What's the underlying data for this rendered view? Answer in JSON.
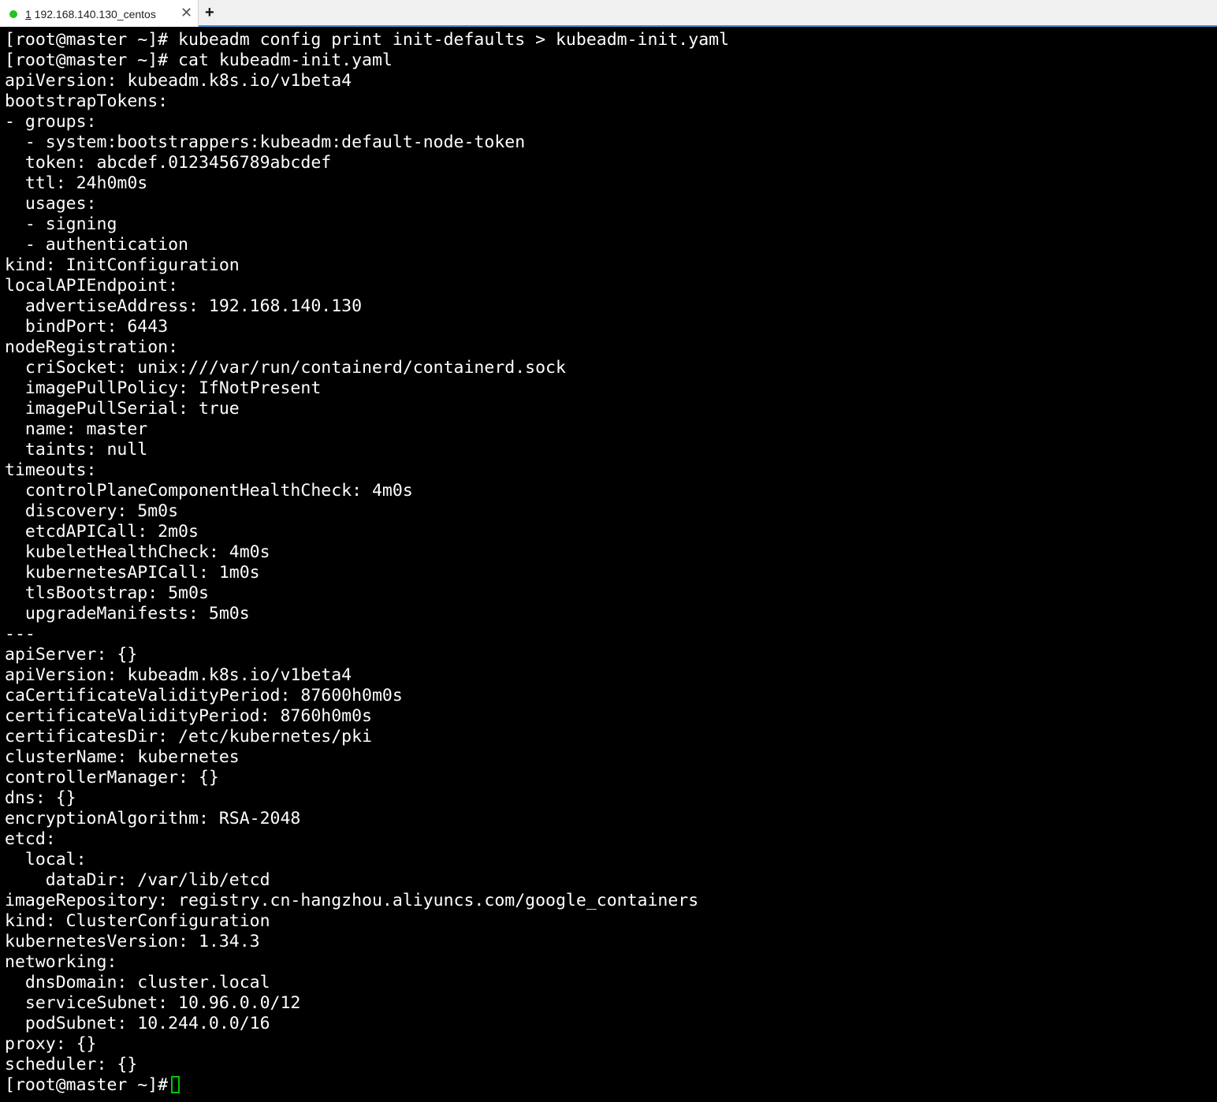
{
  "tab": {
    "number": "1",
    "title": " 192.168.140.130_centos",
    "close": "✕",
    "new_tab": "+"
  },
  "terminal": {
    "lines": [
      "[root@master ~]# kubeadm config print init-defaults > kubeadm-init.yaml",
      "[root@master ~]# cat kubeadm-init.yaml",
      "apiVersion: kubeadm.k8s.io/v1beta4",
      "bootstrapTokens:",
      "- groups:",
      "  - system:bootstrappers:kubeadm:default-node-token",
      "  token: abcdef.0123456789abcdef",
      "  ttl: 24h0m0s",
      "  usages:",
      "  - signing",
      "  - authentication",
      "kind: InitConfiguration",
      "localAPIEndpoint:",
      "  advertiseAddress: 192.168.140.130",
      "  bindPort: 6443",
      "nodeRegistration:",
      "  criSocket: unix:///var/run/containerd/containerd.sock",
      "  imagePullPolicy: IfNotPresent",
      "  imagePullSerial: true",
      "  name: master",
      "  taints: null",
      "timeouts:",
      "  controlPlaneComponentHealthCheck: 4m0s",
      "  discovery: 5m0s",
      "  etcdAPICall: 2m0s",
      "  kubeletHealthCheck: 4m0s",
      "  kubernetesAPICall: 1m0s",
      "  tlsBootstrap: 5m0s",
      "  upgradeManifests: 5m0s",
      "---",
      "apiServer: {}",
      "apiVersion: kubeadm.k8s.io/v1beta4",
      "caCertificateValidityPeriod: 87600h0m0s",
      "certificateValidityPeriod: 8760h0m0s",
      "certificatesDir: /etc/kubernetes/pki",
      "clusterName: kubernetes",
      "controllerManager: {}",
      "dns: {}",
      "encryptionAlgorithm: RSA-2048",
      "etcd:",
      "  local:",
      "    dataDir: /var/lib/etcd",
      "imageRepository: registry.cn-hangzhou.aliyuncs.com/google_containers",
      "kind: ClusterConfiguration",
      "kubernetesVersion: 1.34.3",
      "networking:",
      "  dnsDomain: cluster.local",
      "  serviceSubnet: 10.96.0.0/12",
      "  podSubnet: 10.244.0.0/16",
      "proxy: {}",
      "scheduler: {}"
    ],
    "prompt": "[root@master ~]#"
  },
  "colors": {
    "background": "#000000",
    "text": "#ffffff",
    "cursor": "#00c800",
    "status_dot": "#22c222",
    "tab_accent": "#3c8fd8"
  }
}
